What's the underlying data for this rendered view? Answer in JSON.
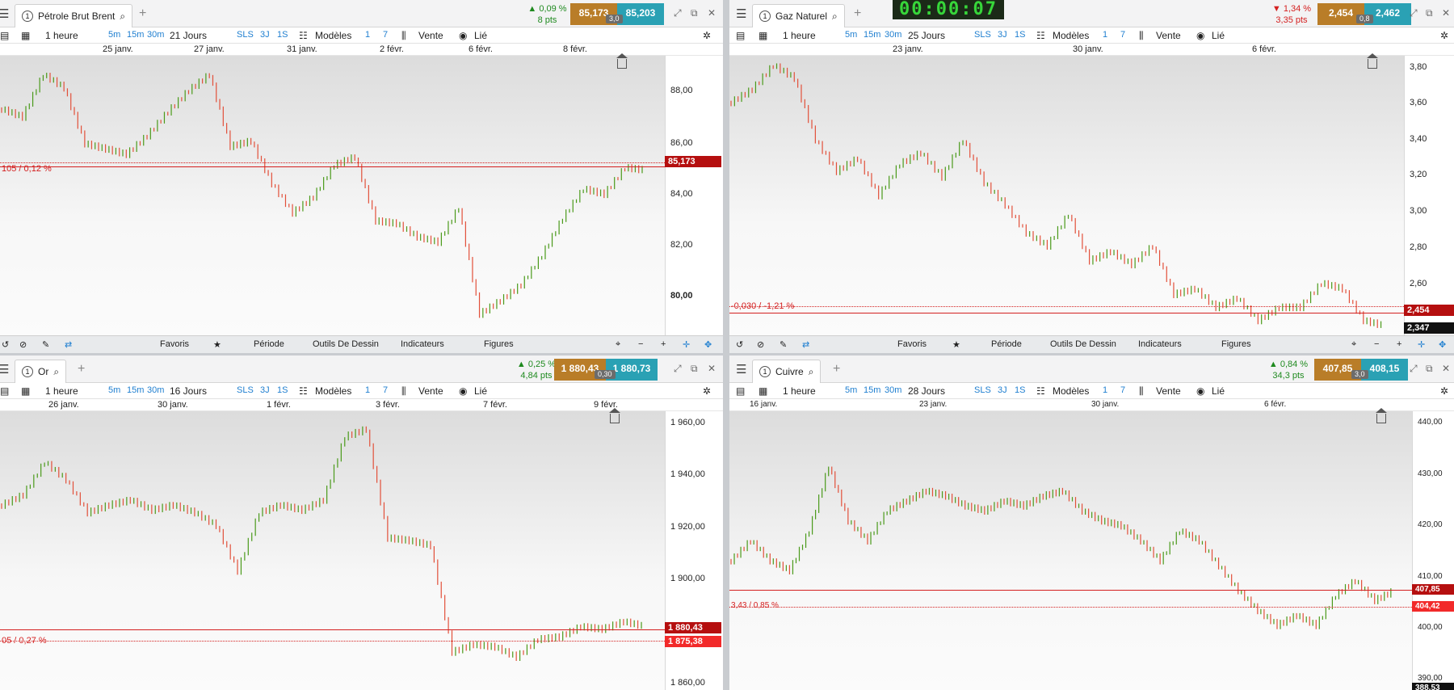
{
  "panels": [
    {
      "id": "brent",
      "instrument": "Pétrole Brut Brent",
      "tab_number": "1",
      "change_pct": "0,09 %",
      "change_pts": "8 pts",
      "direction": "up",
      "bid": "85,173",
      "ask": "85,203",
      "spread": "3,0",
      "interval": "1 heure",
      "period": "21 Jours",
      "toolbar": {
        "tf1": "5m",
        "tf2": "15m",
        "tf3": "30m",
        "sls": "SLS",
        "j3": "3J",
        "s1": "1S",
        "models": "Modèles",
        "q1": "1",
        "q2": "7",
        "sell": "Vente",
        "linked": "Lié"
      },
      "dates": [
        "25 janv.",
        "27 janv.",
        "31 janv.",
        "2 févr.",
        "6 févr.",
        "8 févr."
      ],
      "yticks": [
        "88,00",
        "86,00",
        "84,00",
        "82,00",
        "80,00"
      ],
      "last_price": "85,173",
      "order_label": "105 / 0,12 %",
      "chart_data": {
        "type": "line",
        "ylim": [
          79,
          89.5
        ],
        "values": [
          87.5,
          87.2,
          88.8,
          88.3,
          86.2,
          86.0,
          85.8,
          86.5,
          87.4,
          88.2,
          88.8,
          86.1,
          86.3,
          84.7,
          83.6,
          84.2,
          85.4,
          85.7,
          83.3,
          83.2,
          82.7,
          82.5,
          83.8,
          79.8,
          80.3,
          80.9,
          82.0,
          83.4,
          84.5,
          84.3,
          85.3,
          85.2
        ]
      },
      "bottom": {
        "fav": "Favoris",
        "period": "Période",
        "draw": "Outils De Dessin",
        "ind": "Indicateurs",
        "fig": "Figures"
      }
    },
    {
      "id": "gas",
      "instrument": "Gaz Naturel",
      "tab_number": "1",
      "change_pct": "1,34 %",
      "change_pts": "3,35 pts",
      "direction": "down",
      "bid": "2,454",
      "ask": "2,462",
      "spread": "0,8",
      "interval": "1 heure",
      "period": "25 Jours",
      "toolbar": {
        "tf1": "5m",
        "tf2": "15m",
        "tf3": "30m",
        "sls": "SLS",
        "j3": "3J",
        "s1": "1S",
        "models": "Modèles",
        "q1": "1",
        "q2": "7",
        "sell": "Vente",
        "linked": "Lié"
      },
      "dates": [
        "23 janv.",
        "30 janv.",
        "6 févr."
      ],
      "yticks": [
        "3,80",
        "3,60",
        "3,40",
        "3,20",
        "3,00",
        "2,80",
        "2,60"
      ],
      "last_price": "2,454",
      "low_price": "2,347",
      "order_label": "-0,030 / -1,21 %",
      "chart_data": {
        "type": "line",
        "ylim": [
          2.4,
          3.9
        ],
        "values": [
          3.65,
          3.72,
          3.85,
          3.78,
          3.45,
          3.28,
          3.35,
          3.15,
          3.32,
          3.38,
          3.25,
          3.45,
          3.22,
          3.1,
          2.95,
          2.88,
          3.05,
          2.8,
          2.85,
          2.78,
          2.88,
          2.62,
          2.65,
          2.55,
          2.6,
          2.48,
          2.55,
          2.55,
          2.68,
          2.65,
          2.48,
          2.45
        ]
      },
      "bottom": {
        "fav": "Favoris",
        "period": "Période",
        "draw": "Outils De Dessin",
        "ind": "Indicateurs",
        "fig": "Figures"
      }
    },
    {
      "id": "gold",
      "instrument": "Or",
      "tab_number": "1",
      "change_pct": "0,25 %",
      "change_pts": "4,84 pts",
      "direction": "up",
      "bid": "1 880,43",
      "ask": "1 880,73",
      "spread": "0,30",
      "interval": "1 heure",
      "period": "16 Jours",
      "toolbar": {
        "tf1": "5m",
        "tf2": "15m",
        "tf3": "30m",
        "sls": "SLS",
        "j3": "3J",
        "s1": "1S",
        "models": "Modèles",
        "q1": "1",
        "q2": "7",
        "sell": "Vente",
        "linked": "Lié"
      },
      "dates": [
        "26 janv.",
        "30 janv.",
        "1 févr.",
        "3 févr.",
        "7 févr.",
        "9 févr."
      ],
      "yticks": [
        "1 960,00",
        "1 940,00",
        "1 920,00",
        "1 900,00",
        "1 880,00",
        "1 860,00"
      ],
      "last_price": "1 880,43",
      "order_price": "1 875,38",
      "order_label": "05 / 0,27 %",
      "chart_data": {
        "type": "line",
        "ylim": [
          1855,
          1965
        ],
        "values": [
          1928,
          1932,
          1945,
          1938,
          1925,
          1928,
          1930,
          1926,
          1928,
          1925,
          1920,
          1902,
          1925,
          1928,
          1926,
          1930,
          1955,
          1958,
          1915,
          1914,
          1912,
          1870,
          1873,
          1872,
          1868,
          1875,
          1876,
          1880,
          1879,
          1882,
          1880
        ]
      },
      "bottom": {
        "fav": "",
        "period": "",
        "draw": "",
        "ind": "",
        "fig": ""
      }
    },
    {
      "id": "copper",
      "instrument": "Cuivre",
      "tab_number": "1",
      "change_pct": "0,84 %",
      "change_pts": "34,3 pts",
      "direction": "up",
      "bid": "407,85",
      "ask": "408,15",
      "spread": "3,0",
      "interval": "1 heure",
      "period": "28 Jours",
      "toolbar": {
        "tf1": "5m",
        "tf2": "15m",
        "tf3": "30m",
        "sls": "SLS",
        "j3": "3J",
        "s1": "1S",
        "models": "Modèles",
        "q1": "1",
        "q2": "7",
        "sell": "Vente",
        "linked": "Lié"
      },
      "dates": [
        "16 janv.",
        "23 janv.",
        "30 janv.",
        "6 févr."
      ],
      "yticks": [
        "440,00",
        "430,00",
        "420,00",
        "410,00",
        "400,00",
        "390,00"
      ],
      "last_price": "407,85",
      "order_price": "404,42",
      "low_price": "388,53",
      "order_label": "3,43 / 0,85 %",
      "chart_data": {
        "type": "line",
        "ylim": [
          388,
          444
        ],
        "values": [
          414,
          418,
          414,
          412,
          420,
          433,
          422,
          418,
          424,
          426,
          428,
          427,
          425,
          424,
          426,
          425,
          427,
          428,
          424,
          422,
          421,
          418,
          414,
          420,
          418,
          413,
          408,
          404,
          401,
          403,
          401,
          407,
          410,
          406,
          408
        ]
      },
      "bottom": {
        "fav": "",
        "period": "",
        "draw": "",
        "ind": "",
        "fig": ""
      }
    }
  ],
  "timer": "00:00:07"
}
